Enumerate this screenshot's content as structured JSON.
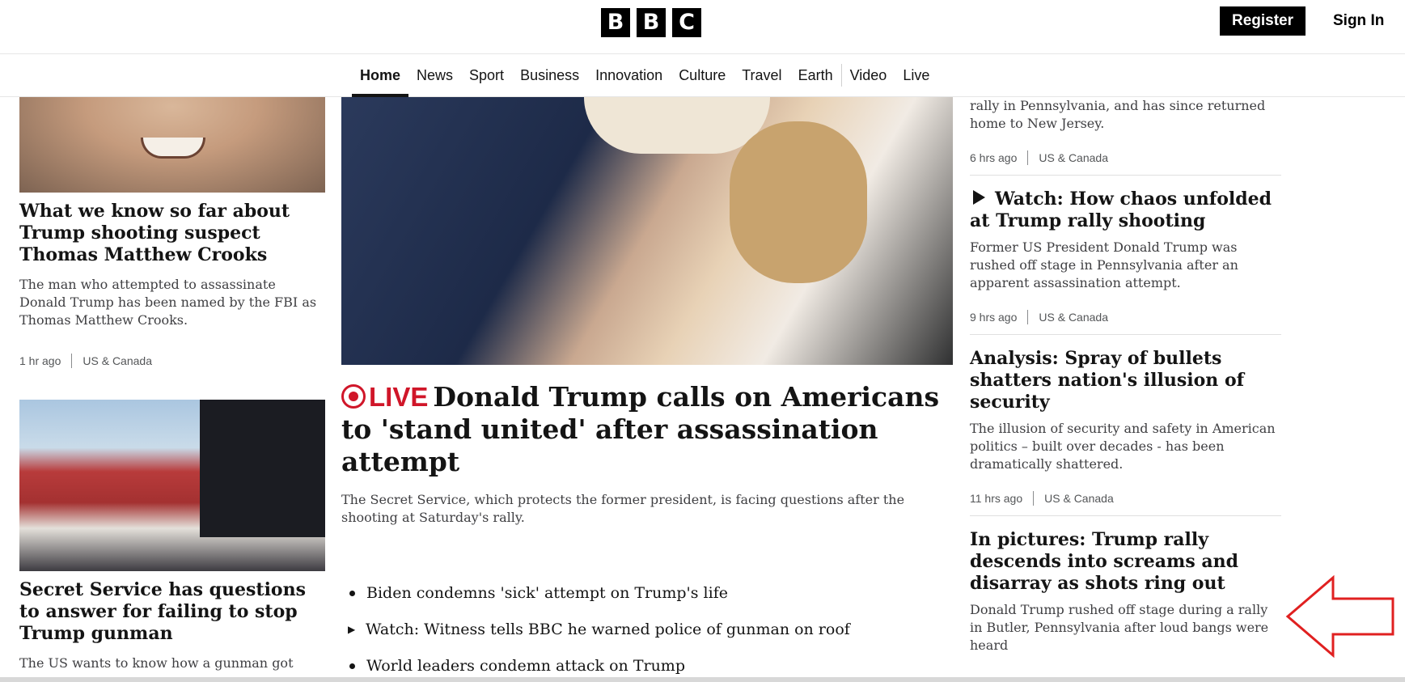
{
  "header": {
    "logo": [
      "B",
      "B",
      "C"
    ],
    "register_label": "Register",
    "signin_label": "Sign In"
  },
  "nav": {
    "items": [
      "Home",
      "News",
      "Sport",
      "Business",
      "Innovation",
      "Culture",
      "Travel",
      "Earth"
    ],
    "items_after_sep": [
      "Video",
      "Live"
    ],
    "active": "Home"
  },
  "left": {
    "story1": {
      "headline": "What we know so far about Trump shooting suspect Thomas Matthew Crooks",
      "summary": "The man who attempted to assassinate Donald Trump has been named by the FBI as Thomas Matthew Crooks.",
      "time": "1 hr ago",
      "section": "US & Canada"
    },
    "story2": {
      "headline": "Secret Service has questions to answer for failing to stop Trump gunman",
      "summary": "The US wants to know how a gunman got"
    }
  },
  "center": {
    "live_label": "LIVE",
    "headline": "Donald Trump calls on Americans to 'stand united' after assassination attempt",
    "summary": "The Secret Service, which protects the former president, is facing questions after the shooting at Saturday's rally.",
    "related": [
      {
        "text": "Biden condemns 'sick' attempt on Trump's life",
        "icon": "bullet"
      },
      {
        "text": "Watch: Witness tells BBC he warned police of gunman on roof",
        "icon": "play"
      },
      {
        "text": "World leaders condemn attack on Trump",
        "icon": "bullet"
      }
    ]
  },
  "right": {
    "story0": {
      "summary": "rally in Pennsylvania, and has since returned home to New Jersey.",
      "time": "6 hrs ago",
      "section": "US & Canada"
    },
    "story1": {
      "headline": "Watch: How chaos unfolded at Trump rally shooting",
      "summary": "Former US President Donald Trump was rushed off stage in Pennsylvania after an apparent assassination attempt.",
      "time": "9 hrs ago",
      "section": "US & Canada"
    },
    "story2": {
      "headline": "Analysis: Spray of bullets shatters nation's illusion of security",
      "summary": "The illusion of security and safety in American politics – built over decades - has been dramatically shattered.",
      "time": "11 hrs ago",
      "section": "US & Canada"
    },
    "story3": {
      "headline": "In pictures: Trump rally descends into screams and disarray as shots ring out",
      "summary": "Donald Trump rushed off stage during a rally in Butler, Pennsylvania after loud bangs were heard"
    }
  },
  "colors": {
    "live_red": "#d01629",
    "annotation_red": "#e02020"
  }
}
